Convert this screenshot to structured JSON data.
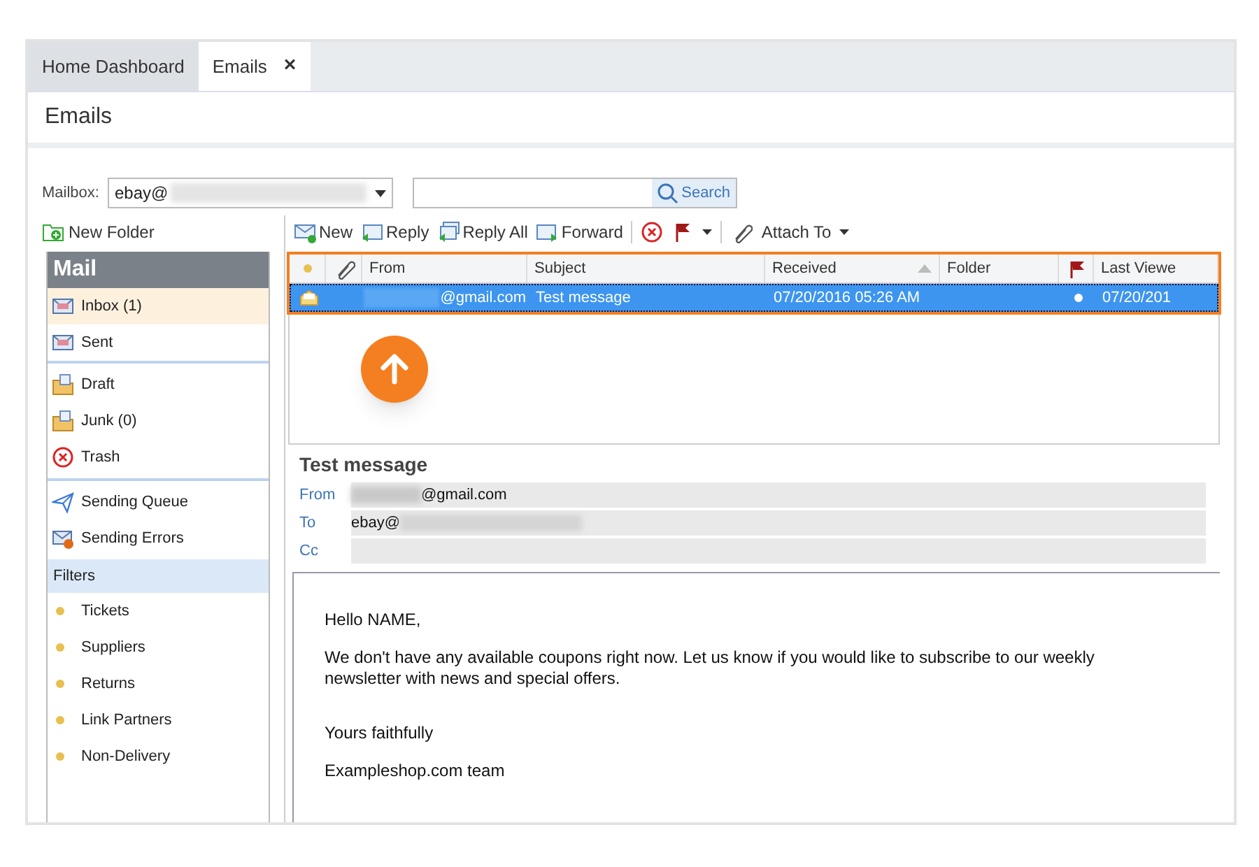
{
  "tabs": [
    {
      "label": "Home Dashboard",
      "selected": false
    },
    {
      "label": "Emails",
      "selected": true,
      "close": "×"
    }
  ],
  "page_title": "Emails",
  "mailbox": {
    "label": "Mailbox:",
    "value": "ebay@",
    "search_button": "Search"
  },
  "new_folder": "New Folder",
  "sidebar": {
    "header": "Mail",
    "sections": [
      {
        "items": [
          {
            "kind": "envelope",
            "label": "Inbox (1)",
            "selected": true
          },
          {
            "kind": "envelope",
            "label": "Sent",
            "selected": false
          }
        ]
      },
      {
        "items": [
          {
            "kind": "folder",
            "label": "Draft",
            "selected": false
          },
          {
            "kind": "folder",
            "label": "Junk (0)",
            "selected": false
          },
          {
            "kind": "trash",
            "label": "Trash",
            "selected": false
          }
        ]
      },
      {
        "items": [
          {
            "kind": "send",
            "label": "Sending Queue",
            "selected": false
          },
          {
            "kind": "error",
            "label": "Sending Errors",
            "selected": false
          }
        ]
      }
    ],
    "filters": {
      "header": "Filters",
      "items": [
        {
          "label": "Tickets"
        },
        {
          "label": "Suppliers"
        },
        {
          "label": "Returns"
        },
        {
          "label": "Link Partners"
        },
        {
          "label": "Non-Delivery"
        }
      ]
    }
  },
  "toolbar": [
    {
      "kind": "new",
      "label": "New"
    },
    {
      "kind": "reply",
      "label": "Reply"
    },
    {
      "kind": "replyall",
      "label": "Reply All"
    },
    {
      "kind": "forward",
      "label": "Forward"
    },
    {
      "kind": "delete"
    },
    {
      "kind": "flag"
    },
    {
      "kind": "attach",
      "label": "Attach To"
    }
  ],
  "grid": {
    "columns": [
      "From",
      "Subject",
      "Received",
      "Folder",
      "Last Viewe"
    ],
    "rows": [
      {
        "from": "@gmail.com",
        "subject": "Test message",
        "received": "07/20/2016 05:26 AM",
        "last_viewed": "07/20/201",
        "selected": true
      }
    ]
  },
  "preview": {
    "subject": "Test message",
    "fields": [
      {
        "label": "From",
        "value": "@gmail.com",
        "blurred_prefix": true
      },
      {
        "label": "To",
        "value": "ebay@",
        "blurred_suffix": true
      },
      {
        "label": "Cc"
      }
    ],
    "body": [
      "Hello NAME,",
      "We don't have any available coupons right now. Let us know if you would like to subscribe to our weekly newsletter with news and special offers.",
      "Yours faithfully",
      "Exampleshop.com team"
    ]
  }
}
